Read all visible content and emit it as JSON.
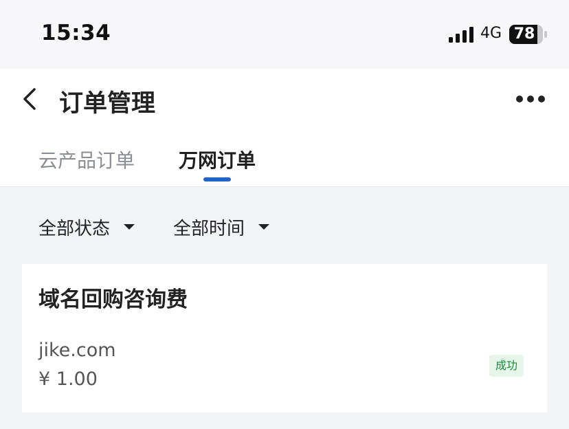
{
  "status_bar": {
    "time": "15:34",
    "network": "4G",
    "battery": "78"
  },
  "header": {
    "title": "订单管理"
  },
  "tabs": [
    {
      "label": "云产品订单",
      "active": false
    },
    {
      "label": "万网订单",
      "active": true
    }
  ],
  "filters": {
    "status": "全部状态",
    "time": "全部时间"
  },
  "orders": [
    {
      "title": "域名回购咨询费",
      "domain": "jike.com",
      "price": "¥ 1.00",
      "status": "成功"
    }
  ],
  "colors": {
    "accent": "#1f64c6",
    "success_text": "#1c8a3c",
    "success_bg": "#e6f7ea",
    "page_bg": "#f3f4f7"
  }
}
